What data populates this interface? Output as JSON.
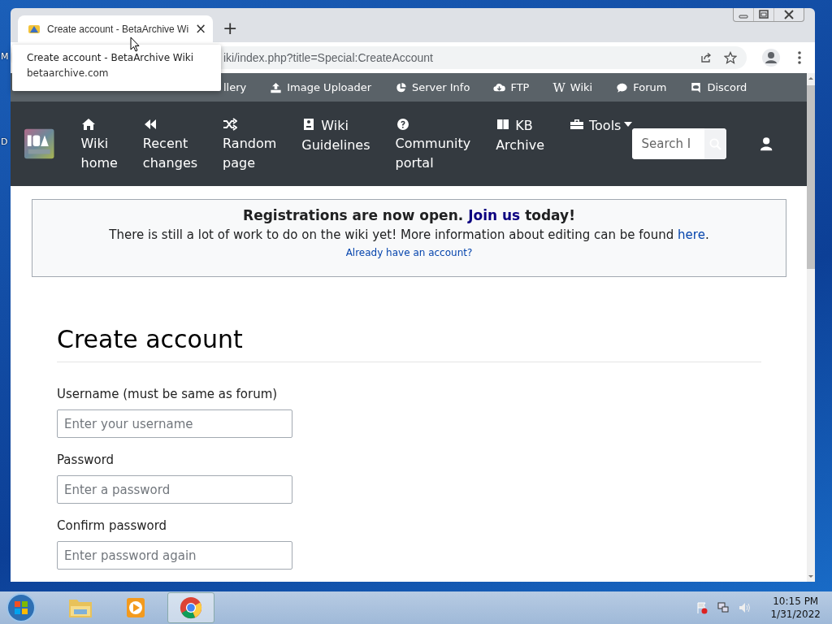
{
  "desktop": {
    "icon_labels": [
      "M",
      "D"
    ]
  },
  "browser": {
    "tab": {
      "title": "Create account - BetaArchive Wi",
      "close": "×",
      "selected": true
    },
    "new_tab": "+",
    "address": "iki/index.php?title=Special:CreateAccount",
    "tooltip": {
      "title": "Create account - BetaArchive Wiki",
      "domain": "betaarchive.com"
    }
  },
  "top_nav": [
    {
      "label": "llery",
      "kind": "plain"
    },
    {
      "label": "Image Uploader",
      "kind": "upload"
    },
    {
      "label": "Server Info",
      "kind": "pie"
    },
    {
      "label": "FTP",
      "kind": "cloud"
    },
    {
      "label": "Wiki",
      "kind": "glyph",
      "glyph": "W"
    },
    {
      "label": "Forum",
      "kind": "chat"
    },
    {
      "label": "Discord",
      "kind": "discord"
    }
  ],
  "main_nav": [
    {
      "lines": [
        "Wiki",
        "home"
      ],
      "kind": "home",
      "icon_inline": false,
      "dropdown": false
    },
    {
      "lines": [
        "Recent",
        "changes"
      ],
      "kind": "rewind",
      "icon_inline": false,
      "dropdown": false
    },
    {
      "lines": [
        "Random",
        "page"
      ],
      "kind": "shuffle",
      "icon_inline": false,
      "dropdown": false
    },
    {
      "lines": [
        "Wiki",
        "Guidelines"
      ],
      "kind": "badge",
      "icon_inline": true,
      "dropdown": false
    },
    {
      "lines": [
        "Community",
        "portal"
      ],
      "kind": "question",
      "icon_inline": false,
      "dropdown": false
    },
    {
      "lines": [
        "KB",
        "Archive"
      ],
      "kind": "book",
      "icon_inline": true,
      "dropdown": false
    },
    {
      "lines": [
        "Tools"
      ],
      "kind": "toolbox",
      "icon_inline": true,
      "dropdown": true
    }
  ],
  "search": {
    "placeholder": "Search I"
  },
  "notice": {
    "title_before": "Registrations are now open. ",
    "title_link": "Join us",
    "title_after": " today!",
    "text_before": "There is still a lot of work to do on the wiki yet! More information about editing can be found ",
    "text_link": "here",
    "text_after": ".",
    "login_link": "Already have an account?"
  },
  "form": {
    "heading": "Create account",
    "fields": [
      {
        "label": "Username (must be same as forum)",
        "placeholder": "Enter your username"
      },
      {
        "label": "Password",
        "placeholder": "Enter a password"
      },
      {
        "label": "Confirm password",
        "placeholder": "Enter password again"
      }
    ]
  },
  "taskbar": {
    "time": "10:15 PM",
    "date": "1/31/2022",
    "apps": [
      {
        "kind": "folder",
        "selected": false
      },
      {
        "kind": "media",
        "selected": false
      },
      {
        "kind": "chrome",
        "selected": true
      }
    ]
  }
}
